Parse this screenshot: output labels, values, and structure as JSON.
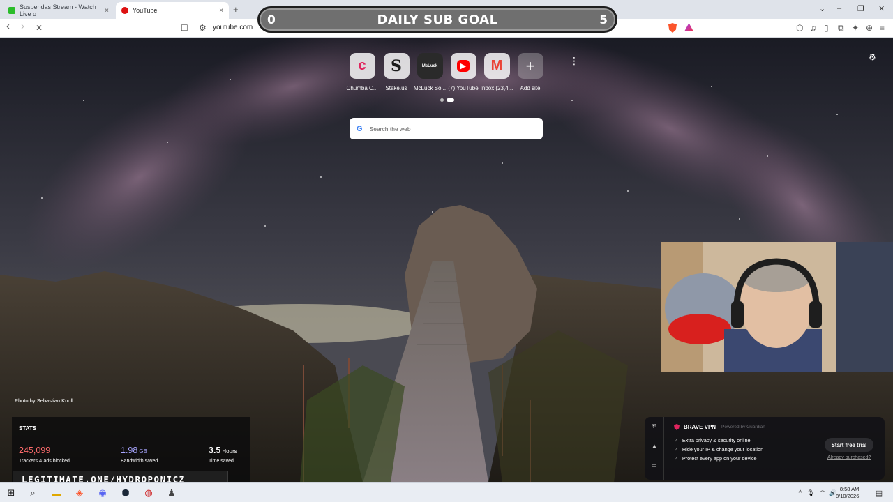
{
  "tabs": [
    {
      "label": "Suspendas Stream - Watch Live o",
      "close": "×"
    },
    {
      "label": "YouTube",
      "close": "×"
    }
  ],
  "new_tab": "+",
  "window_controls": {
    "chevron": "⌄",
    "minimize": "–",
    "restore": "❐",
    "close": "✕"
  },
  "toolbar": {
    "back": "‹",
    "forward": "›",
    "stop": "✕",
    "bookmark": "☐",
    "site_settings": "⚙",
    "url": "youtube.com",
    "right_icons": [
      "⬡",
      "♫",
      "▯",
      "⧉",
      "✦",
      "⊕",
      "≡"
    ]
  },
  "sub_goal": {
    "current": "0",
    "title": "DAILY SUB GOAL",
    "target": "5"
  },
  "shortcuts": [
    {
      "label": "Chumba C...",
      "glyph": "c",
      "color": "#e0245e"
    },
    {
      "label": "Stake.us",
      "glyph": "S",
      "color": "#1b1b1b"
    },
    {
      "label": "McLuck So...",
      "glyph": "McLuck",
      "color": "#2a2a2a"
    },
    {
      "label": "(7) YouTube",
      "glyph": "▶",
      "color": "#ff0000"
    },
    {
      "label": "Inbox (23,4...",
      "glyph": "M",
      "color": "#ea4335"
    },
    {
      "label": "Add site",
      "glyph": "+",
      "color": "#ffffff"
    }
  ],
  "more_menu": "⋮",
  "settings_gear": "⚙",
  "search": {
    "google_glyph": "G",
    "placeholder": "Search the web"
  },
  "photo_credit": "Photo by Sebastian Knoll",
  "stats": {
    "title": "STATS",
    "items": [
      {
        "value": "245,099",
        "unit": "",
        "caption": "Trackers & ads blocked",
        "color": "#fc6b6b"
      },
      {
        "value": "1.98",
        "unit": "GB",
        "caption": "Bandwidth saved",
        "color": "#a8a6ff"
      },
      {
        "value": "3.5",
        "unit": "Hours",
        "caption": "Time saved",
        "color": "#ffffff"
      }
    ]
  },
  "overlay_link": "LEGITIMATE.ONE/HYDROPONICZ",
  "vpn": {
    "title": "BRAVE VPN",
    "powered_by": "Powered by Guardian",
    "features": [
      "Extra privacy & security online",
      "Hide your IP & change your location",
      "Protect every app on your device"
    ],
    "cta": "Start free trial",
    "already": "Already purchased?",
    "side_icons": [
      "⛨",
      "▲",
      "▭"
    ]
  },
  "taskbar": {
    "icons": [
      "⊞",
      "⌕",
      "▬",
      "◈",
      "◉",
      "⬢",
      "◍",
      "♟"
    ],
    "tray": [
      "^",
      "🎙",
      "◠",
      "🔊"
    ],
    "time": "8:58 AM",
    "date": "8/10/2026"
  }
}
